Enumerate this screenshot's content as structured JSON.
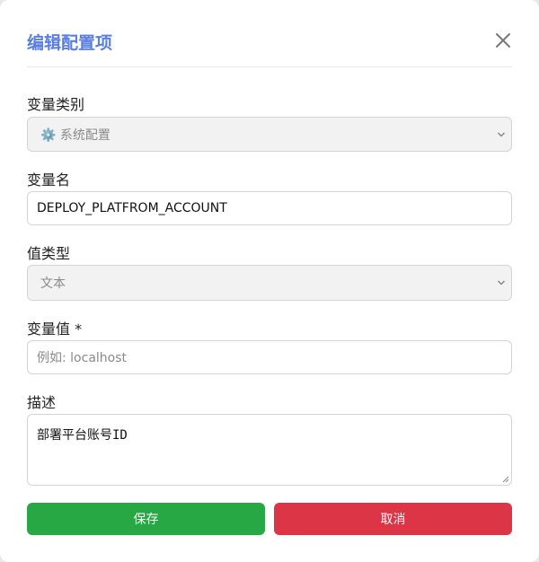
{
  "dialog": {
    "title": "编辑配置项",
    "close_icon": "close-icon"
  },
  "form": {
    "category": {
      "label": "变量类别",
      "value": "⚙️ 系统配置",
      "disabled": true
    },
    "name": {
      "label": "变量名",
      "value": "DEPLOY_PLATFROM_ACCOUNT"
    },
    "value_type": {
      "label": "值类型",
      "value": "文本",
      "disabled": true
    },
    "variable_value": {
      "label": "变量值 *",
      "value": "",
      "placeholder": "例如: localhost"
    },
    "description": {
      "label": "描述",
      "value": "部署平台账号ID"
    }
  },
  "buttons": {
    "save": "保存",
    "cancel": "取消"
  },
  "colors": {
    "title": "#5b7fe0",
    "save": "#28a745",
    "cancel": "#dc3545"
  }
}
